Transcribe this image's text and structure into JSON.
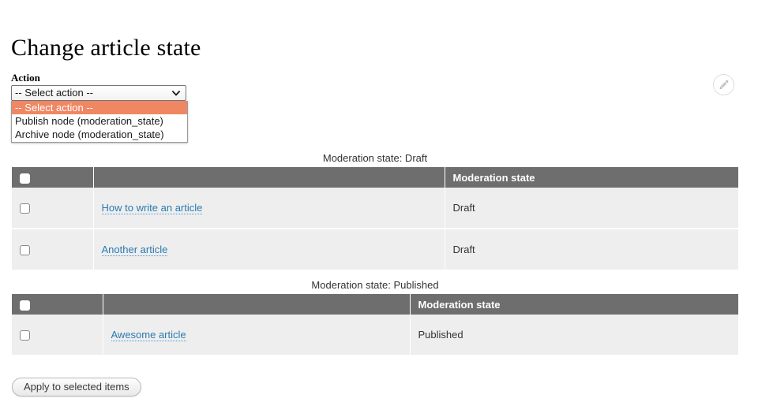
{
  "page": {
    "title": "Change article state"
  },
  "action_form": {
    "label": "Action",
    "select": {
      "name": "action-select",
      "value": "-- Select action --",
      "expanded": true,
      "options": [
        {
          "label": "-- Select action --",
          "selected": true
        },
        {
          "label": "Publish node (moderation_state)",
          "selected": false
        },
        {
          "label": "Archive node (moderation_state)",
          "selected": false
        }
      ]
    },
    "highlight_color": "#f08763"
  },
  "contextual": {
    "icon": "pencil-icon"
  },
  "tables": [
    {
      "caption": "Moderation state: Draft",
      "columns": [
        "",
        "",
        "Moderation state"
      ],
      "rows": [
        {
          "title": "How to write an article",
          "state": "Draft"
        },
        {
          "title": "Another article",
          "state": "Draft"
        }
      ]
    },
    {
      "caption": "Moderation state: Published",
      "columns": [
        "",
        "",
        "Moderation state"
      ],
      "rows": [
        {
          "title": "Awesome article",
          "state": "Published"
        }
      ]
    }
  ],
  "footer": {
    "apply_label": "Apply to selected items"
  },
  "colors": {
    "header_bg": "#6e6e6e",
    "row_bg": "#eeeeee",
    "link": "#2a7ab0",
    "highlight": "#f08763"
  }
}
